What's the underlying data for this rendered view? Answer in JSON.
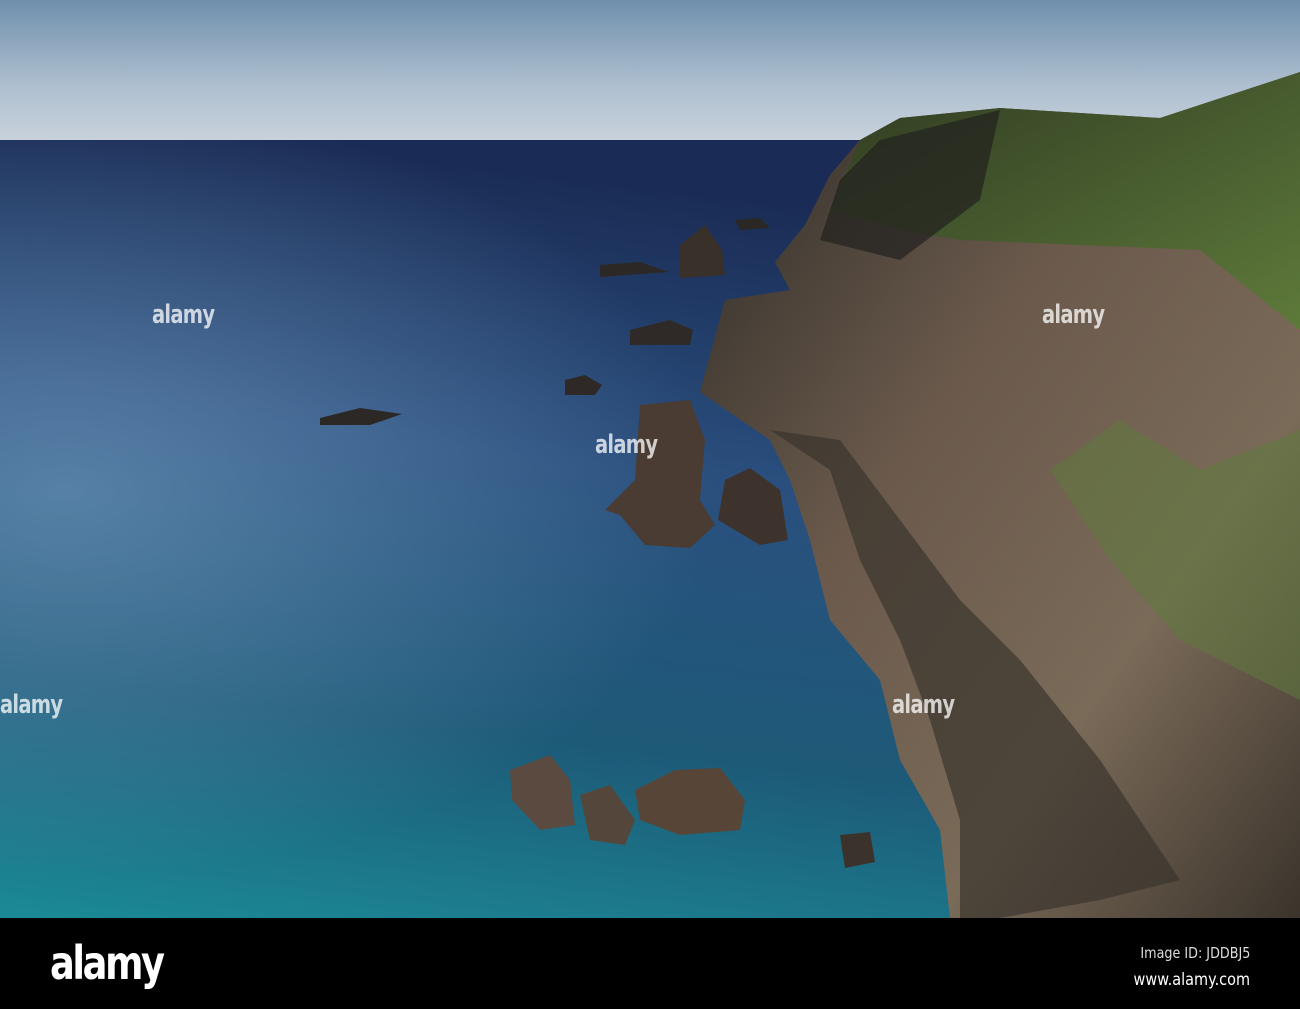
{
  "photo": {
    "subject": "coastal-cliffs-sea-stacks"
  },
  "watermark": {
    "brand": "alamy"
  },
  "footer": {
    "logo": "alamy",
    "image_id": "Image ID: JDDBJ5",
    "url": "www.alamy.com"
  }
}
